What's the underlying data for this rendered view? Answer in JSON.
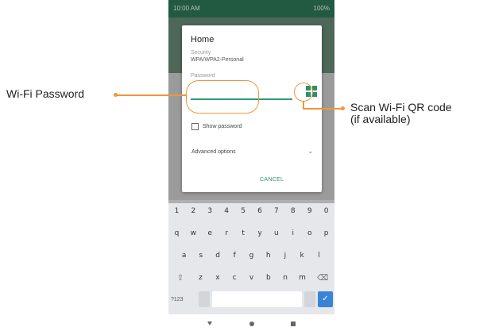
{
  "status_bar": {
    "time": "10:00 AM",
    "right_status": "100%"
  },
  "dialog": {
    "network_name": "Home",
    "security_label": "Security",
    "security_value": "WPA/WPA2-Personal",
    "password_label": "Password",
    "password_value": "",
    "qr_icon": "qr-scan-icon",
    "show_password_label": "Show password",
    "show_password_checked": false,
    "advanced_options_label": "Advanced options",
    "advanced_options_icon": "chevron-down-icon",
    "cancel_label": "CANCEL"
  },
  "keyboard": {
    "numbers": [
      "1",
      "2",
      "3",
      "4",
      "5",
      "6",
      "7",
      "8",
      "9",
      "0"
    ],
    "row1": [
      "q",
      "w",
      "e",
      "r",
      "t",
      "y",
      "u",
      "i",
      "o",
      "p"
    ],
    "row2": [
      "a",
      "s",
      "d",
      "f",
      "g",
      "h",
      "j",
      "k",
      "l"
    ],
    "row3": [
      "z",
      "x",
      "c",
      "v",
      "b",
      "n",
      "m"
    ],
    "shift_icon": "shift-icon",
    "backspace_icon": "backspace-icon",
    "symbols_label": "?123",
    "comma_label": ",",
    "period_label": ".",
    "enter_icon": "check-icon"
  },
  "navbar": {
    "back_icon": "back-icon",
    "home_icon": "home-icon",
    "recents_icon": "recents-icon"
  },
  "callouts": {
    "password_callout": "Wi-Fi Password",
    "qr_callout_line1": "Scan Wi-Fi QR code",
    "qr_callout_line2": "(if available)"
  },
  "colors": {
    "accent": "#2e8f68",
    "callout": "#f0963c",
    "keyboard_enter": "#3a84d6"
  }
}
